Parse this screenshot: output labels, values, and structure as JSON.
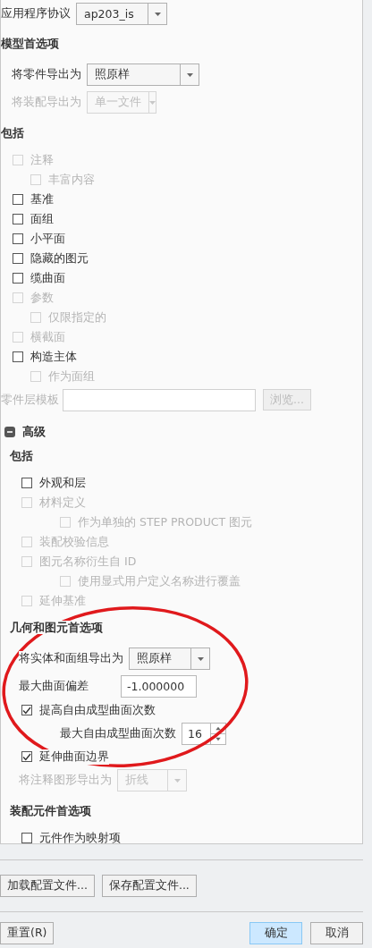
{
  "protocol": {
    "label": "应用程序协议",
    "value": "ap203_is",
    "disabled": false
  },
  "items": [
    {
      "kind": "heading",
      "text": "模型首选项"
    },
    {
      "kind": "select",
      "label": "将零件导出为",
      "value": "照原样",
      "disabled": false
    },
    {
      "kind": "select",
      "label": "将装配导出为",
      "value": "单一文件",
      "disabled": true
    },
    {
      "kind": "heading",
      "text": "包括"
    },
    {
      "kind": "checkbox",
      "label": "注释",
      "checked": false,
      "disabled": true,
      "children": [
        {
          "kind": "checkbox",
          "label": "丰富内容",
          "checked": false,
          "disabled": true
        }
      ]
    },
    {
      "kind": "checkbox",
      "label": "基准",
      "checked": false,
      "disabled": false
    },
    {
      "kind": "checkbox",
      "label": "面组",
      "checked": false,
      "disabled": false
    },
    {
      "kind": "checkbox",
      "label": "小平面",
      "checked": false,
      "disabled": false
    },
    {
      "kind": "checkbox",
      "label": "隐藏的图元",
      "checked": false,
      "disabled": false
    },
    {
      "kind": "checkbox",
      "label": "缆曲面",
      "checked": false,
      "disabled": false
    },
    {
      "kind": "checkbox",
      "label": "参数",
      "checked": false,
      "disabled": true,
      "children": [
        {
          "kind": "checkbox",
          "label": "仅限指定的",
          "checked": false,
          "disabled": true
        }
      ]
    },
    {
      "kind": "checkbox",
      "label": "横截面",
      "checked": false,
      "disabled": true
    },
    {
      "kind": "checkbox",
      "label": "构造主体",
      "checked": false,
      "disabled": false,
      "children": [
        {
          "kind": "checkbox",
          "label": "作为面组",
          "checked": false,
          "disabled": true
        }
      ]
    },
    {
      "kind": "template",
      "label": "零件层模板",
      "button": "浏览...",
      "disabled": true
    },
    {
      "kind": "group",
      "label": "高级",
      "expanded": true,
      "items": [
        {
          "kind": "heading",
          "text": "包括"
        },
        {
          "kind": "checkbox",
          "label": "外观和层",
          "checked": false,
          "disabled": false
        },
        {
          "kind": "checkbox",
          "label": "材料定义",
          "checked": false,
          "disabled": true,
          "children": [
            {
              "kind": "checkbox",
              "label": "作为单独的 STEP PRODUCT 图元",
              "checked": false,
              "disabled": true
            }
          ]
        },
        {
          "kind": "checkbox",
          "label": "装配校验信息",
          "checked": false,
          "disabled": true
        },
        {
          "kind": "checkbox",
          "label": "图元名称衍生自 ID",
          "checked": false,
          "disabled": true,
          "children": [
            {
              "kind": "checkbox",
              "label": "使用显式用户定义名称进行覆盖",
              "checked": false,
              "disabled": true
            }
          ]
        },
        {
          "kind": "checkbox",
          "label": "延伸基准",
          "checked": false,
          "disabled": true
        },
        {
          "kind": "heading",
          "text": "几何和图元首选项"
        },
        {
          "kind": "select",
          "label": "将实体和面组导出为",
          "value": "照原样",
          "disabled": false
        },
        {
          "kind": "number",
          "label": "最大曲面偏差",
          "value": "-1.000000"
        },
        {
          "kind": "checkbox",
          "label": "提高自由成型曲面次数",
          "checked": true,
          "disabled": false,
          "children": [
            {
              "kind": "spinner",
              "label": "最大自由成型曲面次数",
              "value": "16"
            }
          ]
        },
        {
          "kind": "checkbox",
          "label": "延伸曲面边界",
          "checked": true,
          "disabled": false
        },
        {
          "kind": "select",
          "label": "将注释图形导出为",
          "value": "折线",
          "disabled": true
        },
        {
          "kind": "heading",
          "text": "装配元件首选项"
        },
        {
          "kind": "checkbox",
          "label": "元件作为映射项",
          "checked": false,
          "disabled": false
        }
      ]
    }
  ],
  "profile_buttons": [
    {
      "label": "加载配置文件..."
    },
    {
      "label": "保存配置文件..."
    }
  ],
  "dialog_buttons": [
    {
      "label": "重置(R)",
      "default": false
    },
    {
      "label": "确定",
      "default": true
    },
    {
      "label": "取消",
      "default": false
    }
  ]
}
